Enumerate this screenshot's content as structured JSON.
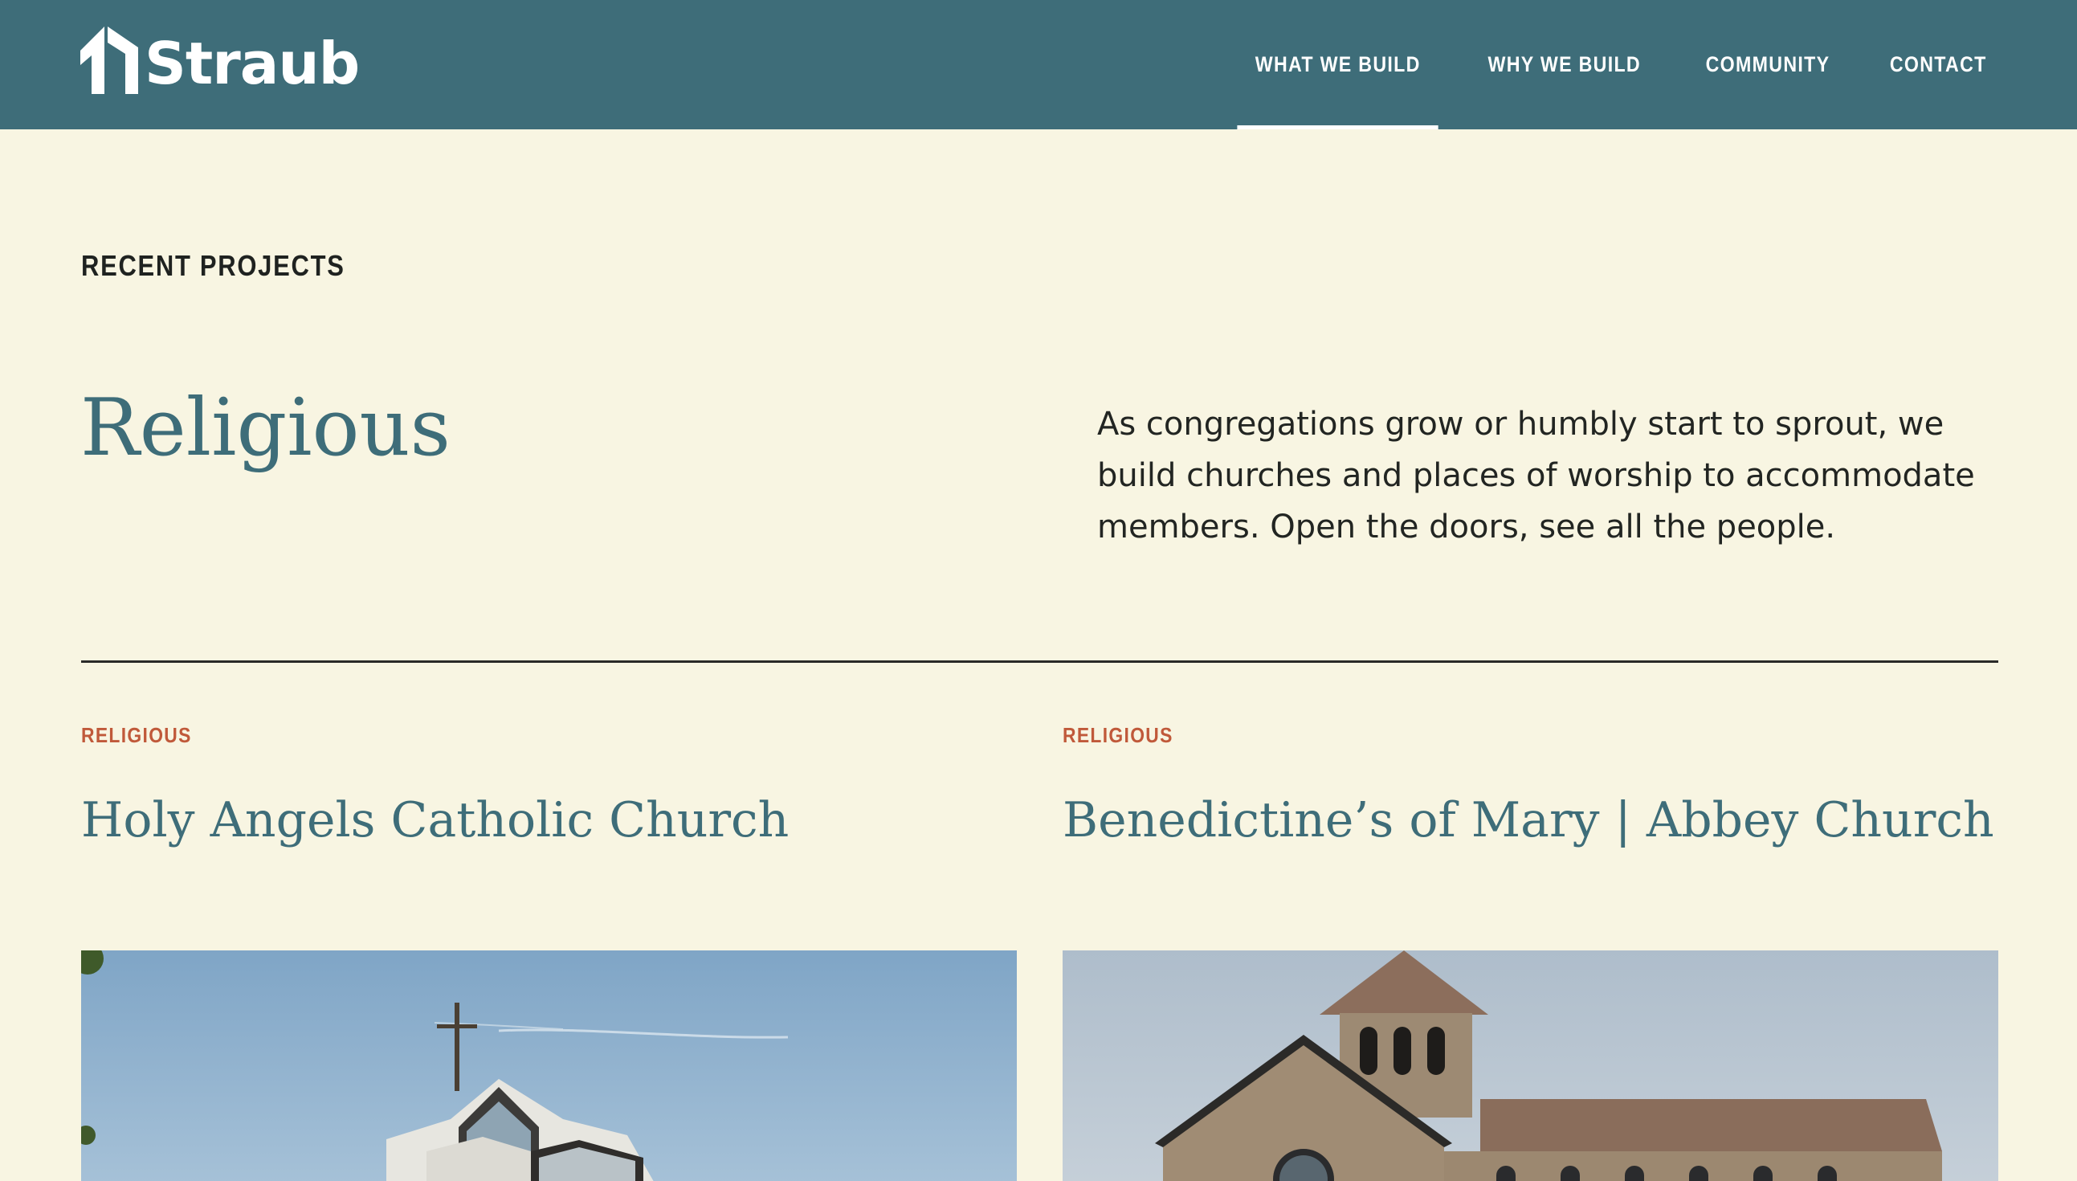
{
  "header": {
    "logo_text": "Straub",
    "nav": [
      {
        "label": "WHAT WE BUILD",
        "active": true
      },
      {
        "label": "WHY WE BUILD",
        "active": false
      },
      {
        "label": "COMMUNITY",
        "active": false
      },
      {
        "label": "CONTACT",
        "active": false
      }
    ]
  },
  "intro": {
    "eyebrow": "RECENT PROJECTS",
    "title": "Religious",
    "description": "As congregations grow or humbly start to sprout, we build churches and places of worship to accommodate members. Open the doors, see all the people."
  },
  "projects": [
    {
      "category": "RELIGIOUS",
      "title": "Holy Angels Catholic Church",
      "image_icon": "church-photo"
    },
    {
      "category": "RELIGIOUS",
      "title": "Benedictine’s of Mary | Abbey Church",
      "image_icon": "abbey-photo"
    }
  ],
  "colors": {
    "header_bg": "#3e6d79",
    "page_bg": "#f8f5e2",
    "accent": "#c0593a",
    "heading": "#3e6d79"
  }
}
